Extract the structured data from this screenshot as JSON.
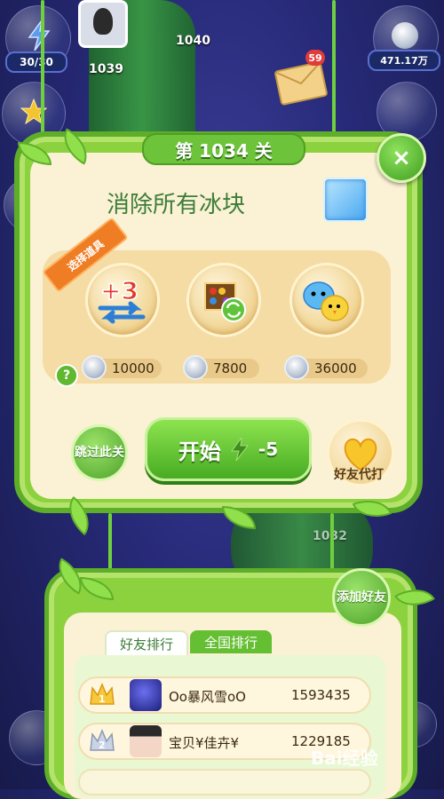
{
  "hud": {
    "energy": "30/30",
    "coins": "471.17万",
    "mail_badge": "59"
  },
  "map": {
    "level_nodes": [
      "1040",
      "1039",
      "1032"
    ]
  },
  "dialog": {
    "title": "第 1034 关",
    "close_label": "×",
    "goal": "消除所有冰块",
    "ribbon": "选择道具",
    "props": [
      {
        "icon": "plus-three-moves-icon",
        "price": "10000"
      },
      {
        "icon": "shuffle-board-icon",
        "price": "7800"
      },
      {
        "icon": "animal-swap-icon",
        "price": "36000"
      }
    ],
    "help": "?",
    "skip_label": "跳过此关",
    "start_label": "开始",
    "start_cost": "-5",
    "friend_play_label": "好友代打"
  },
  "board": {
    "add_friend_label": "添加好友",
    "tabs": [
      "好友排行",
      "全国排行"
    ],
    "rows": [
      {
        "rank": "1",
        "name": "Oo暴风雪oO",
        "score": "1593435"
      },
      {
        "rank": "2",
        "name": "宝贝¥佳卉¥",
        "score": "1229185"
      }
    ]
  },
  "watermark": "Bai经验",
  "colors": {
    "accent_green": "#6dc43a",
    "panel_cream": "#fbf1d4",
    "ribbon_orange": "#ee7d24"
  }
}
